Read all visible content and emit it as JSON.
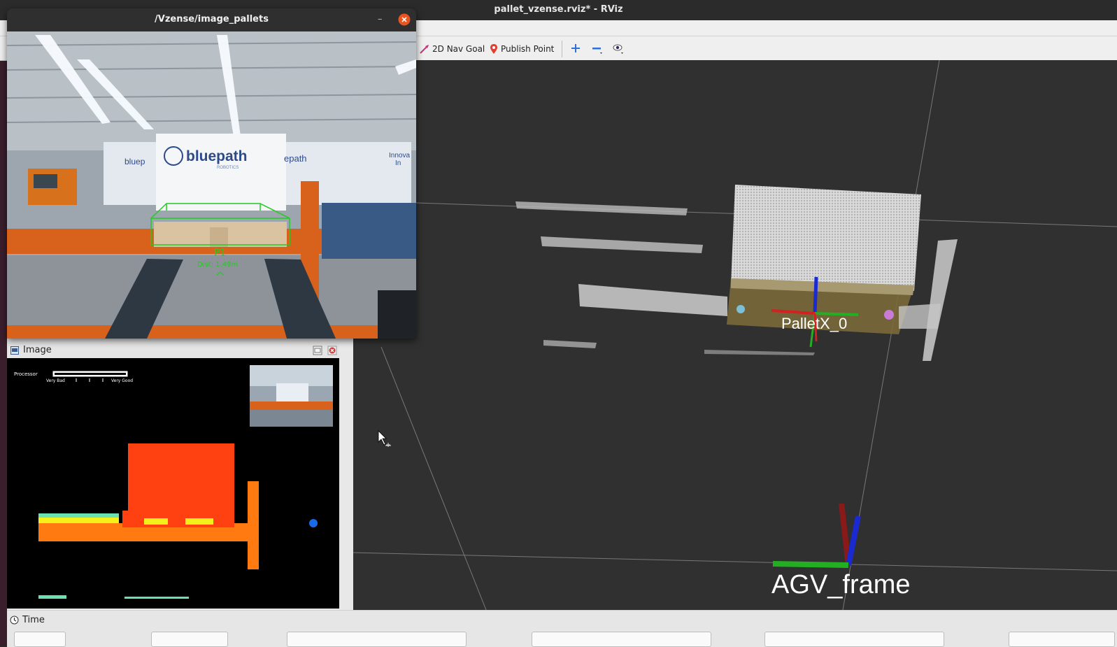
{
  "rviz": {
    "window_title": "pallet_vzense.rviz* - RViz",
    "toolbar": {
      "nav_goal_label": "2D Nav Goal",
      "publish_point_label": "Publish Point",
      "zoom_in_icon": "plus-icon",
      "zoom_out_icon": "minus-icon",
      "eye_icon": "eye-icon"
    }
  },
  "view3d": {
    "pallet_label": "PalletX_0",
    "base_frame_label": "AGV_frame"
  },
  "image_window": {
    "title": "/Vzense/image_pallets",
    "detection_label": "P1",
    "detection_distance": "Dist: 1.49m",
    "banner_brand": "bluepath",
    "banner_sub": "ROBOTICS",
    "banner_side_left": "bluep",
    "banner_side_right": "epath",
    "banner_far_right": "Innova",
    "banner_far_right2": "In"
  },
  "image_panel": {
    "title": "Image",
    "processor_label": "Processor",
    "scale_left": "Very Bad",
    "scale_right": "Very Good"
  },
  "time_panel": {
    "title": "Time"
  },
  "colors": {
    "detection_green": "#22cc22",
    "axis_red": "#d42020",
    "axis_green": "#22b022",
    "axis_blue": "#1a2ad0",
    "depth_red": "#ff4010",
    "depth_orange": "#ff7a10",
    "depth_yellow": "#f6f01a"
  }
}
